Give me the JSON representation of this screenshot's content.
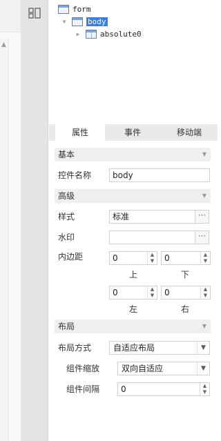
{
  "tree": {
    "nodes": [
      {
        "label": "form",
        "expander": "",
        "icon": "form-widget-icon"
      },
      {
        "label": "body",
        "expander": "▼",
        "icon": "body-widget-icon"
      },
      {
        "label": "absolute0",
        "expander": "▶",
        "icon": "absolute-layout-icon"
      }
    ]
  },
  "tabs": {
    "properties": "属性",
    "events": "事件",
    "mobile": "移动端"
  },
  "sections": {
    "basic": "基本",
    "advanced": "高级",
    "layout": "布局"
  },
  "basic": {
    "widget_name_label": "控件名称",
    "widget_name_value": "body"
  },
  "advanced": {
    "style_label": "样式",
    "style_value": "标准",
    "style_button": "···",
    "watermark_label": "水印",
    "watermark_value": "",
    "watermark_button": "···",
    "padding_label": "内边距",
    "padding": {
      "top": {
        "value": "0",
        "label": "上"
      },
      "bottom": {
        "value": "0",
        "label": "下"
      },
      "left": {
        "value": "0",
        "label": "左"
      },
      "right": {
        "value": "0",
        "label": "右"
      }
    }
  },
  "layout": {
    "mode_label": "布局方式",
    "mode_value": "自适应布局",
    "scale_label": "组件缩放",
    "scale_value": "双向自适应",
    "spacing_label": "组件间隔",
    "spacing_value": "0"
  },
  "icons": {
    "structure": "structure-icon",
    "collapse": "chevron-down-icon",
    "spin_up": "▲",
    "spin_down": "▼",
    "select_drop": "▼",
    "section_chevron": "▼",
    "scroll_up": "▲"
  },
  "colors": {
    "selection": "#3b7fd7",
    "tab_bar": "#e9e9e9",
    "rail": "#e4e4e4"
  }
}
